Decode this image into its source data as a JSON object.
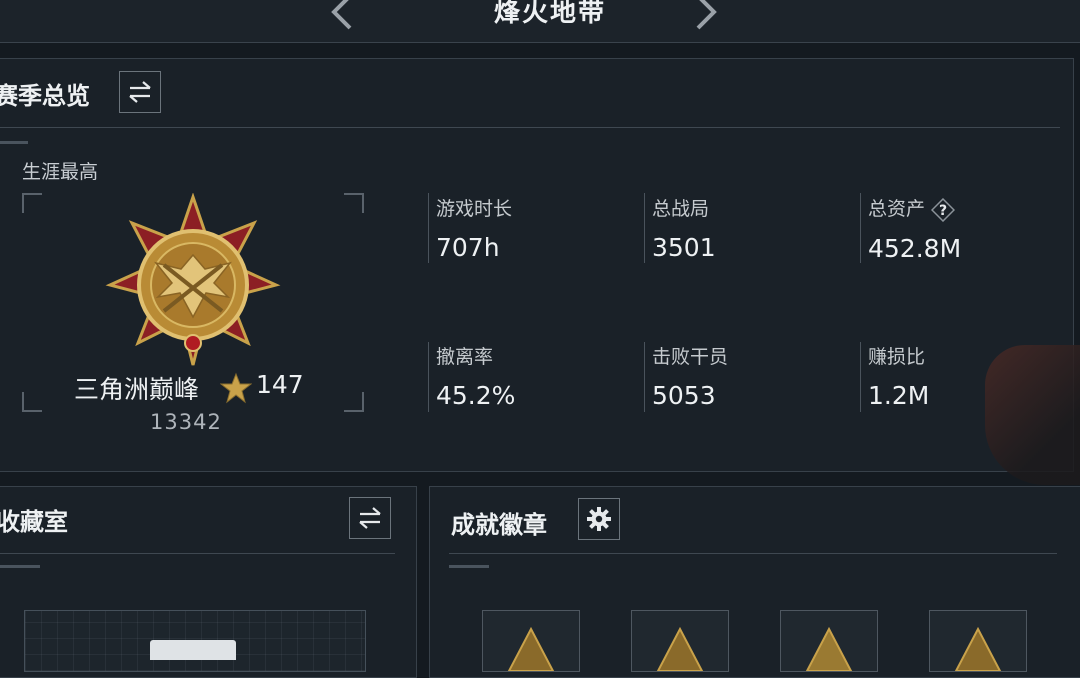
{
  "header": {
    "title": "烽火地带",
    "prev_icon": "chevron-left-icon",
    "next_icon": "chevron-right-icon"
  },
  "season": {
    "title": "赛季总览",
    "switch_icon": "switch-arrows-icon",
    "career_label": "生涯最高",
    "rank": {
      "name": "三角洲巅峰",
      "star_icon": "star-icon",
      "stars": "147",
      "score": "13342"
    },
    "stats": [
      {
        "label": "游戏时长",
        "value": "707h"
      },
      {
        "label": "总战局",
        "value": "3501"
      },
      {
        "label": "总资产",
        "value": "452.8M",
        "help_icon": "question-icon"
      },
      {
        "label": "撤离率",
        "value": "45.2%"
      },
      {
        "label": "击败干员",
        "value": "5053"
      },
      {
        "label": "赚损比",
        "value": "1.2M"
      }
    ]
  },
  "collection": {
    "title": "收藏室",
    "switch_icon": "switch-arrows-icon"
  },
  "achievements": {
    "title": "成就徽章",
    "settings_icon": "gear-icon"
  },
  "colors": {
    "background": "#141a20",
    "panel": "#1a2128",
    "border": "#38414a",
    "gold": "#c9a24a",
    "medal_red": "#8c1f24"
  }
}
